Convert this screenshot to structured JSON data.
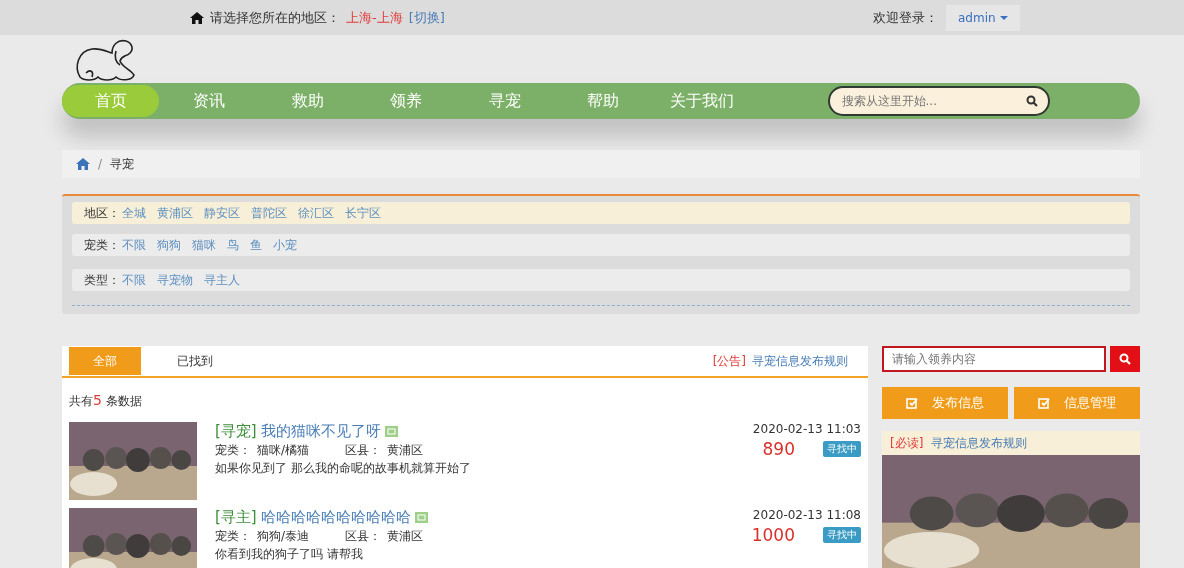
{
  "top_bar": {
    "region_prompt": "请选择您所在的地区：",
    "region": "上海-上海",
    "switch_link": "[切换]",
    "welcome": "欢迎登录：",
    "user": "admin"
  },
  "nav": {
    "items": [
      {
        "label": "首页",
        "selected": true
      },
      {
        "label": "资讯",
        "selected": false
      },
      {
        "label": "救助",
        "selected": false
      },
      {
        "label": "领养",
        "selected": false
      },
      {
        "label": "寻宠",
        "selected": false
      },
      {
        "label": "帮助",
        "selected": false
      },
      {
        "label": "关于我们",
        "selected": false
      }
    ],
    "search": {
      "placeholder": "搜索从这里开始..."
    }
  },
  "breadcrumb": {
    "separator": "/",
    "current": "寻宠"
  },
  "filters": [
    {
      "label": "地区：",
      "highlighted": true,
      "options": [
        "全城",
        "黄浦区",
        "静安区",
        "普陀区",
        "徐汇区",
        "长宁区"
      ]
    },
    {
      "label": "宠类：",
      "highlighted": false,
      "options": [
        "不限",
        "狗狗",
        "猫咪",
        "鸟",
        "鱼",
        "小宠"
      ]
    },
    {
      "label": "类型：",
      "highlighted": false,
      "options": [
        "不限",
        "寻宠物",
        "寻主人"
      ]
    }
  ],
  "list": {
    "tabs": [
      {
        "label": "全部",
        "selected": true
      },
      {
        "label": "已找到",
        "selected": false
      }
    ],
    "notice_tag": "[公告]",
    "notice_link": "寻宠信息发布规则",
    "count_prefix": "共有",
    "count": "5",
    "count_suffix": " 条数据",
    "items": [
      {
        "tag": "[寻宠]",
        "title": "我的猫咪不见了呀",
        "pet_label": "宠类：",
        "pet": "猫咪/橘猫",
        "district_label": "区县：",
        "district": "黄浦区",
        "description": "如果你见到了 那么我的命呢的故事机就算开始了",
        "date": "2020-02-13 11:03",
        "reward": "890",
        "status": "寻找中"
      },
      {
        "tag": "[寻主]",
        "title": "哈哈哈哈哈哈哈哈哈哈",
        "pet_label": "宠类：",
        "pet": "狗狗/泰迪",
        "district_label": "区县：",
        "district": "黄浦区",
        "description": "你看到我的狗子了吗 请帮我",
        "date": "2020-02-13 11:08",
        "reward": "1000",
        "status": "寻找中"
      }
    ]
  },
  "sidebar": {
    "search": {
      "placeholder": "请输入领养内容"
    },
    "buttons": [
      "发布信息",
      "信息管理"
    ],
    "notice_tag": "[必读]",
    "notice_link": "寻宠信息发布规则"
  }
}
